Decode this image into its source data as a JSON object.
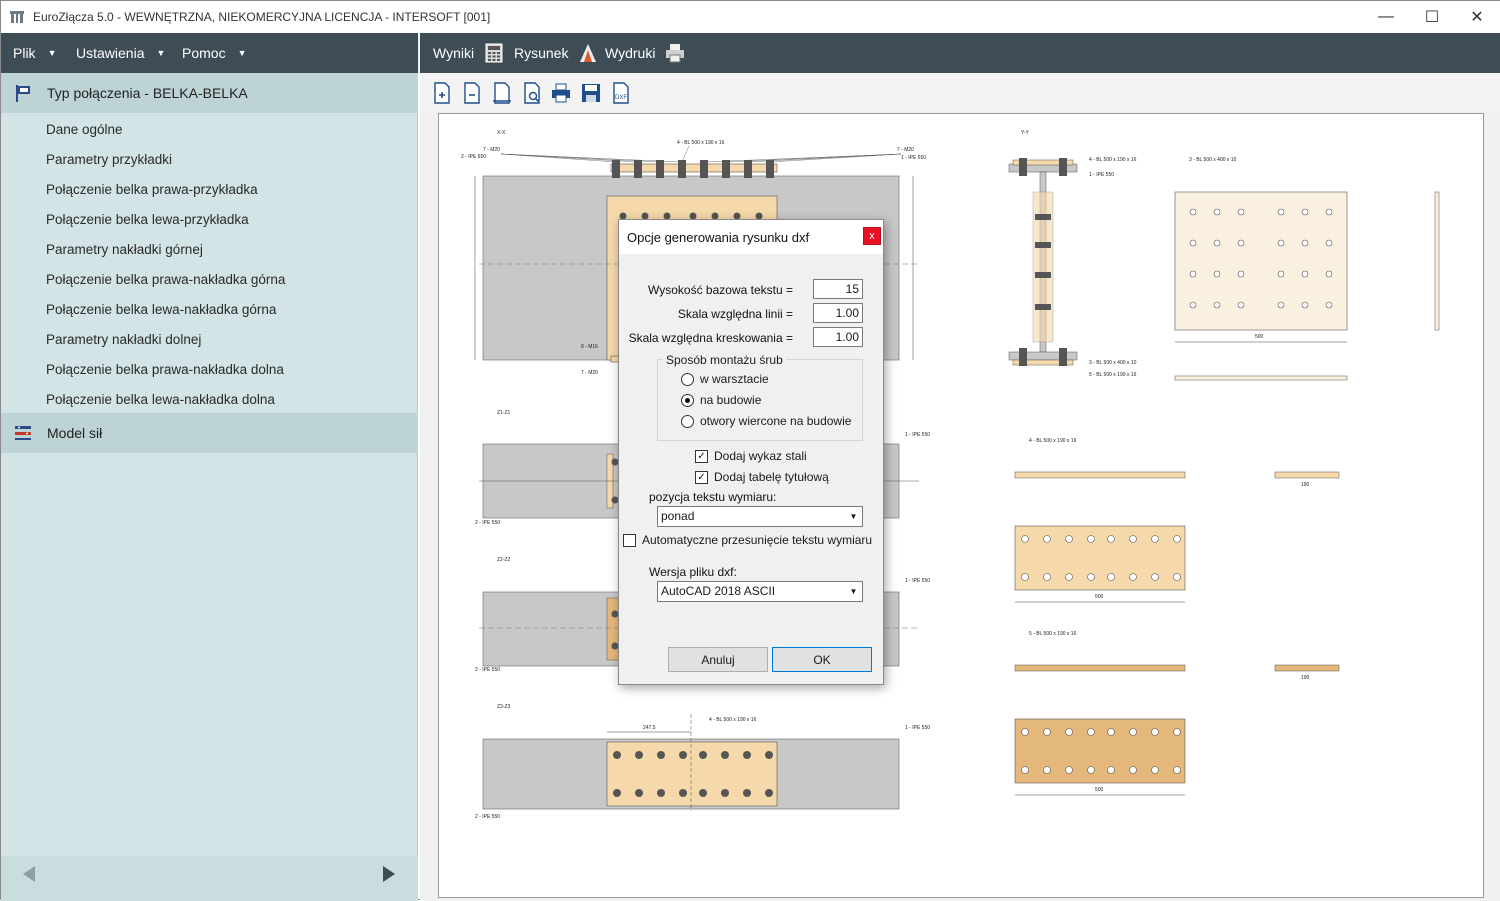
{
  "window": {
    "title": "EuroZłącza 5.0 - WEWNĘTRZNA, NIEKOMERCYJNA LICENCJA - INTERSOFT [001]",
    "minimize": "—",
    "maximize": "☐",
    "close": "✕"
  },
  "menubar": {
    "plik": "Plik",
    "ustawienia": "Ustawienia",
    "pomoc": "Pomoc",
    "caret": "▼",
    "wyniki": "Wyniki",
    "rysunek": "Rysunek",
    "wydruki": "Wydruki"
  },
  "sidebar": {
    "section1": "Typ połączenia - BELKA-BELKA",
    "items": [
      "Dane ogólne",
      "Parametry przykładki",
      "Połączenie belka prawa-przykładka",
      "Połączenie belka lewa-przykładka",
      "Parametry nakładki górnej",
      "Połączenie belka prawa-nakładka górna",
      "Połączenie belka lewa-nakładka górna",
      "Parametry nakładki dolnej",
      "Połączenie belka prawa-nakładka dolna",
      "Połączenie belka lewa-nakładka dolna"
    ],
    "section2": "Model sił"
  },
  "drawing": {
    "xx": "X-X",
    "yy": "Y-Y",
    "z1": "Z1-Z1",
    "z2": "Z2-Z2",
    "z3": "Z3-Z3",
    "ipe": "2 - IPE 550",
    "ipe1": "1 - IPE 550",
    "m20": "7 - M20",
    "m16": "8 - M16",
    "bl4": "4 - BL 500 x 190 x 16",
    "bl3": "3 - BL 500 x 400 x 10",
    "bl5": "5 - BL 500 x 190 x 16",
    "d500": "500",
    "d190": "190",
    "d2475": "247.5"
  },
  "dialog": {
    "title": "Opcje generowania rysunku dxf",
    "close": "x",
    "text_height_label": "Wysokość bazowa tekstu =",
    "text_height": "15",
    "line_scale_label": "Skala względna linii =",
    "line_scale": "1.00",
    "hatch_scale_label": "Skala względna kreskowania =",
    "hatch_scale": "1.00",
    "bolt_group": "Sposób montażu śrub",
    "radio1": "w warsztacie",
    "radio2": "na budowie",
    "radio3": "otwory wiercone na budowie",
    "check1": "Dodaj wykaz stali",
    "check2": "Dodaj tabelę tytułową",
    "dim_pos_label": "pozycja tekstu wymiaru:",
    "dim_pos": "ponad",
    "auto_shift": "Automatyczne przesunięcie tekstu wymiaru",
    "dxf_version_label": "Wersja pliku dxf:",
    "dxf_version": "AutoCAD 2018 ASCII",
    "cancel": "Anuluj",
    "ok": "OK",
    "checkmark": "✓",
    "arrow": "▼"
  },
  "colors": {
    "menubar": "#3d4c55",
    "sidebar": "#d3e4e6",
    "sidebar_section": "#bdd3d5",
    "plate": "#f5d9aa",
    "beam": "#c8c8c8"
  }
}
